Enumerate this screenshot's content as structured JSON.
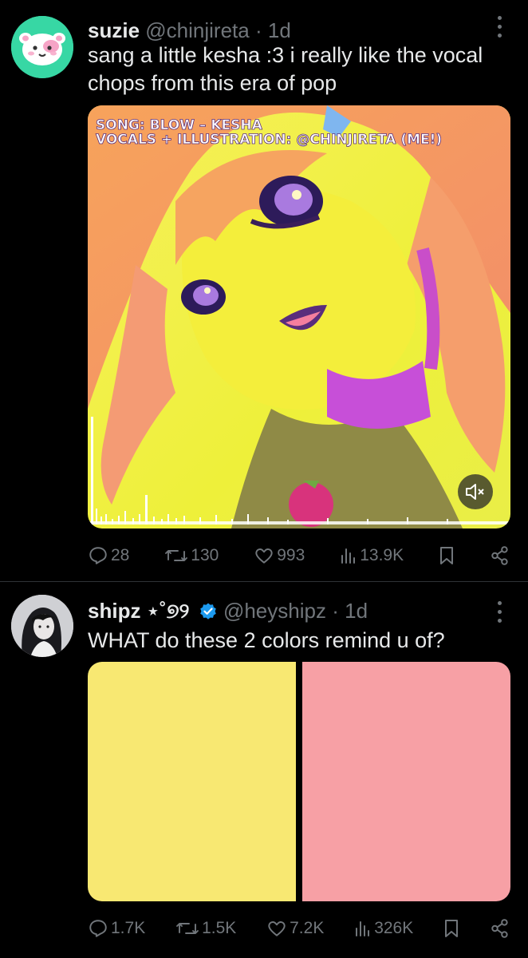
{
  "posts": [
    {
      "name": "suzie",
      "handle": "@chinjireta",
      "separator": "·",
      "time": "1d",
      "text": "sang a little kesha :3 i really like the vocal chops from this era of pop",
      "media": {
        "line1": "SONG: BLOW – KESHA",
        "line2": "VOCALS + ILLUSTRATION: @CHINJIRETA (ME!)",
        "mute_icon": "speaker-muted-icon"
      },
      "stats": {
        "replies": "28",
        "reposts": "130",
        "likes": "993",
        "views": "13.9K"
      }
    },
    {
      "name": "shipz",
      "name_deco": "⋆˚୭୨",
      "verified": true,
      "handle": "@heyshipz",
      "separator": "·",
      "time": "1d",
      "text": "WHAT do these 2 colors remind u of?",
      "swatches": [
        "#f8e872",
        "#f7a0a5"
      ],
      "stats": {
        "replies": "1.7K",
        "reposts": "1.5K",
        "likes": "7.2K",
        "views": "326K"
      }
    }
  ],
  "colors": {
    "accent": "#1d9bf0",
    "muted": "#71767b",
    "text": "#e7e9ea",
    "background": "#000000"
  }
}
